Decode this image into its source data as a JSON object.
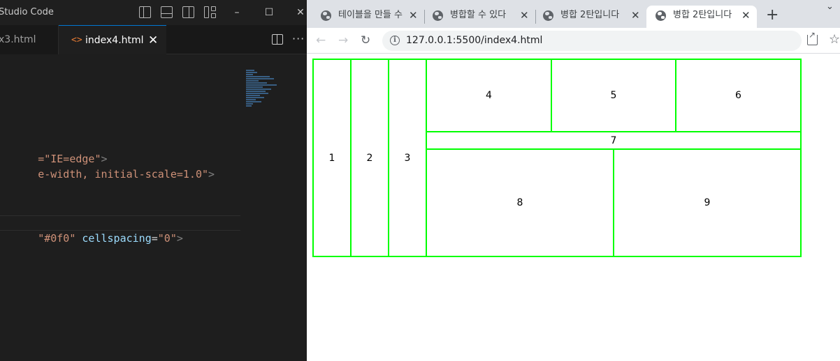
{
  "vscode": {
    "app_name": "Studio Code",
    "tabs": [
      {
        "label": "x3.html"
      },
      {
        "label": "index4.html",
        "close": "✕",
        "icon": "html-file-icon"
      }
    ],
    "code_lines": [
      {
        "str": "=\"IE=edge\"",
        "punc": ">"
      },
      {
        "str": "e-width, initial-scale=1.0\"",
        "punc": ">"
      },
      {
        "str": "\"#0f0\"",
        "attr": "cellspacing",
        "eq": "=",
        "str2": "\"0\"",
        "punc": ">"
      }
    ]
  },
  "browser": {
    "tabs": [
      {
        "title": "테이블을 만들 수"
      },
      {
        "title": "병합할 수 있다"
      },
      {
        "title": "병합 2탄입니다"
      },
      {
        "title": "병합 2탄입니다"
      }
    ],
    "close_glyph": "✕",
    "new_tab": "+",
    "url": "127.0.0.1:5500/index4.html"
  },
  "table": {
    "border_color": "#00ff00",
    "cells": {
      "c1": "1",
      "c2": "2",
      "c3": "3",
      "c4": "4",
      "c5": "5",
      "c6": "6",
      "c7": "7",
      "c8": "8",
      "c9": "9"
    }
  },
  "colors": {
    "editor_bg": "#1e1e1e",
    "string": "#ce9178",
    "attribute": "#9cdcfe",
    "accent": "#0078d4",
    "tab_strip": "#dee1e6"
  }
}
